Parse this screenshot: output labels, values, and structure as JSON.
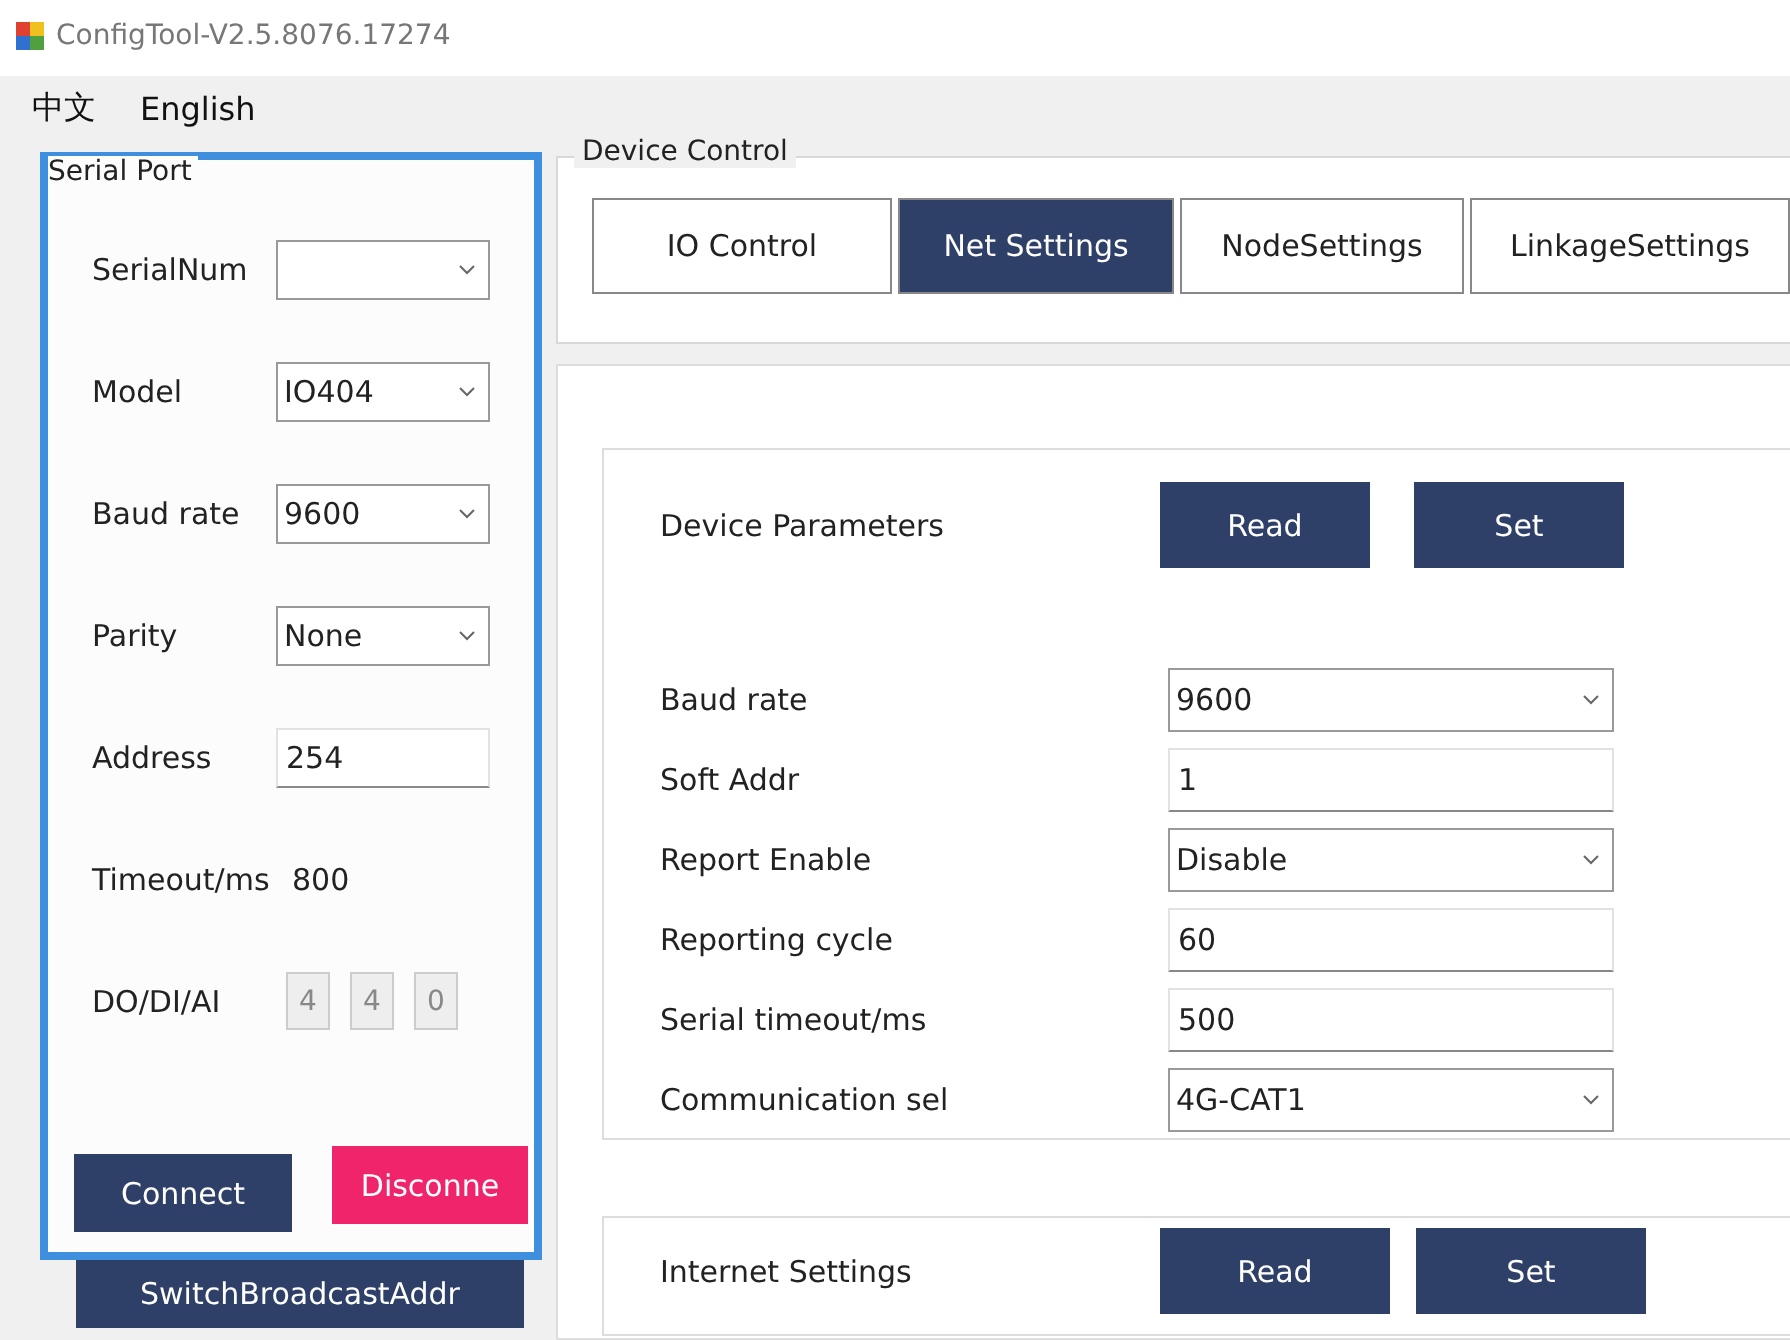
{
  "window": {
    "title": "ConfigTool-V2.5.8076.17274"
  },
  "menu": [
    {
      "label": "中文"
    },
    {
      "label": "English"
    }
  ],
  "serial_port": {
    "title": "Serial Port",
    "fields": [
      {
        "kind": "select",
        "label": "SerialNum"
      },
      {
        "kind": "select",
        "label": "Model",
        "value": "IO404"
      },
      {
        "kind": "select",
        "label": "Baud rate",
        "value": "9600"
      },
      {
        "kind": "select",
        "label": "Parity",
        "value": "None"
      },
      {
        "kind": "input",
        "label": "Address",
        "value": "254"
      },
      {
        "kind": "text",
        "label": "Timeout/ms",
        "value": "800"
      },
      {
        "kind": "counts",
        "label": "DO/DI/AI",
        "values": [
          "4",
          "4",
          "0"
        ]
      }
    ],
    "buttons": [
      {
        "label": "Connect",
        "kind": "primary"
      },
      {
        "label": "Disconne",
        "kind": "danger"
      }
    ],
    "switch_button": "SwitchBroadcastAddr"
  },
  "device_control": {
    "title": "Device Control",
    "tabs": [
      {
        "label": "IO Control",
        "selected": false
      },
      {
        "label": "Net Settings",
        "selected": true
      },
      {
        "label": "NodeSettings",
        "selected": false
      },
      {
        "label": "LinkageSettings",
        "selected": false
      }
    ]
  },
  "device_parameters": {
    "title": "Device Parameters",
    "buttons": [
      "Read",
      "Set"
    ],
    "fields": [
      {
        "kind": "select",
        "label": "Baud rate",
        "value": "9600"
      },
      {
        "kind": "input",
        "label": "Soft Addr",
        "value": "1"
      },
      {
        "kind": "select",
        "label": "Report Enable",
        "value": "Disable"
      },
      {
        "kind": "input",
        "label": "Reporting cycle",
        "value": "60"
      },
      {
        "kind": "input",
        "label": "Serial timeout/ms",
        "value": "500"
      },
      {
        "kind": "select",
        "label": "Communication sel",
        "value": "4G-CAT1"
      }
    ]
  },
  "internet_settings": {
    "title": "Internet Settings",
    "buttons": [
      "Read",
      "Set"
    ]
  }
}
